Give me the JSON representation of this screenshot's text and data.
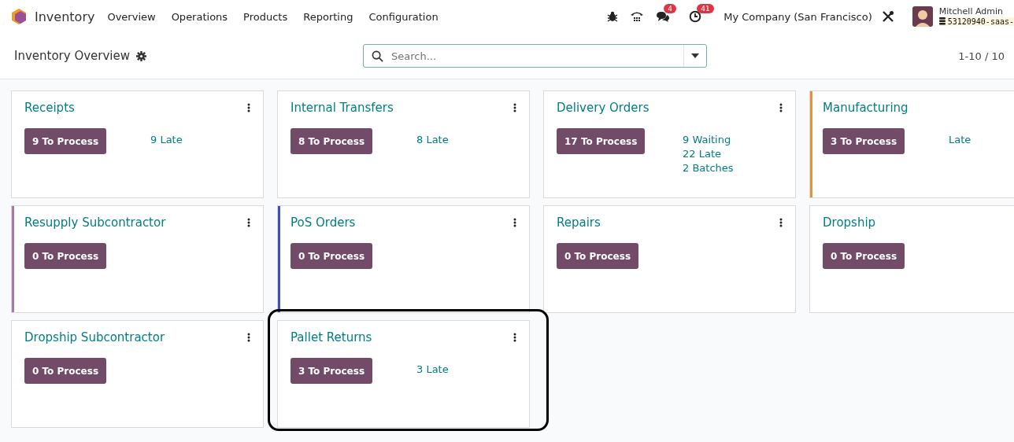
{
  "navbar": {
    "app_name": "Inventory",
    "menu": [
      "Overview",
      "Operations",
      "Products",
      "Reporting",
      "Configuration"
    ],
    "messages_badge": "4",
    "activities_badge": "41",
    "company": "My Company (San Francisco)",
    "user": "Mitchell Admin",
    "database": "53120940-saas-"
  },
  "control_panel": {
    "title": "Inventory Overview",
    "search": {
      "placeholder": "Search..."
    },
    "pager": "1-10 / 10"
  },
  "cards": [
    {
      "title": "Receipts",
      "button": "9 To Process",
      "stats": [
        "9 Late"
      ],
      "menu": true,
      "highlighted": false
    },
    {
      "title": "Internal Transfers",
      "button": "8 To Process",
      "stats": [
        "8 Late"
      ],
      "menu": true,
      "highlighted": false
    },
    {
      "title": "Delivery Orders",
      "button": "17 To Process",
      "stats": [
        "9 Waiting",
        "22 Late",
        "2 Batches"
      ],
      "menu": true,
      "highlighted": false
    },
    {
      "title": "Manufacturing",
      "button": "3 To Process",
      "stats": [
        "Late"
      ],
      "color": "#e8913a",
      "menu": false,
      "highlighted": false
    },
    {
      "title": "Resupply Subcontractor",
      "button": "0 To Process",
      "color": "#a77aa6",
      "menu": true,
      "highlighted": false
    },
    {
      "title": "PoS Orders",
      "button": "0 To Process",
      "color": "#3d50c8",
      "menu": true,
      "highlighted": false
    },
    {
      "title": "Repairs",
      "button": "0 To Process",
      "menu": true,
      "highlighted": false
    },
    {
      "title": "Dropship",
      "button": "0 To Process",
      "menu": false,
      "highlighted": false
    },
    {
      "title": "Dropship Subcontractor",
      "button": "0 To Process",
      "menu": true,
      "highlighted": false
    },
    {
      "title": "Pallet Returns",
      "button": "3 To Process",
      "stats": [
        "3 Late"
      ],
      "menu": true,
      "highlighted": true
    }
  ]
}
